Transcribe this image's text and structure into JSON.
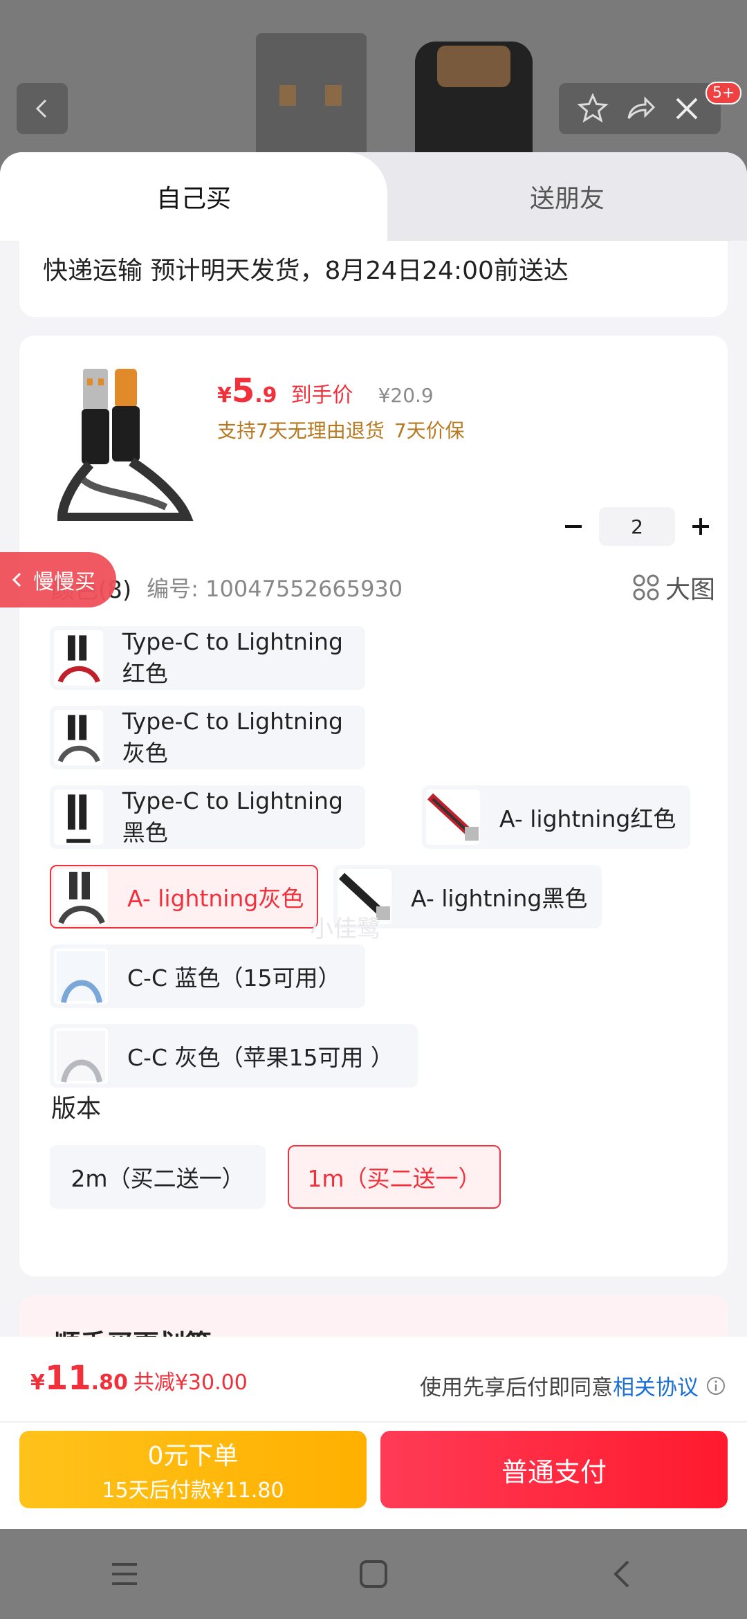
{
  "header": {
    "badge": "5+"
  },
  "tabs": {
    "self": "自己买",
    "friend": "送朋友"
  },
  "delivery": {
    "text": "快递运输 预计明天发货，8月24日24:00前送达"
  },
  "product": {
    "currency": "¥",
    "price_int": "5",
    "price_dec": ".9",
    "price_label": "到手价",
    "original_price": "¥20.9",
    "guarantees": [
      "支持7天无理由退货",
      "7天价保"
    ],
    "quantity": "2"
  },
  "color_section": {
    "title": "颜色(8)",
    "code": "编号: 10047552665930",
    "big_image_label": "大图",
    "options": [
      {
        "label": "Type-C to Lightning红色",
        "accent": "#c0202a",
        "selected": false
      },
      {
        "label": "Type-C to Lightning灰色",
        "accent": "#555555",
        "selected": false
      },
      {
        "label": "Type-C to Lightning黑色",
        "accent": "#222222",
        "selected": false
      },
      {
        "label": "A- lightning红色",
        "accent": "#c0202a",
        "selected": false
      },
      {
        "label": "A- lightning灰色",
        "accent": "#555555",
        "selected": true
      },
      {
        "label": "A- lightning黑色",
        "accent": "#222222",
        "selected": false
      },
      {
        "label": "C-C  蓝色（15可用）",
        "accent": "#7aa7d8",
        "selected": false
      },
      {
        "label": "C-C  灰色（苹果15可用 ）",
        "accent": "#b8b8c0",
        "selected": false
      }
    ]
  },
  "version_section": {
    "title": "版本",
    "options": [
      {
        "label": "2m（买二送一）",
        "selected": false
      },
      {
        "label": "1m（买二送一）",
        "selected": true
      }
    ]
  },
  "bundle": {
    "title": "顺手买更划算"
  },
  "float_tag": {
    "label": "慢慢买"
  },
  "watermark": "小佳鹭",
  "paybar": {
    "currency": "¥",
    "total_int": "11",
    "total_dec": ".80",
    "saving": "共减¥30.00",
    "agree_prefix": "使用先享后付即同意",
    "agree_link": "相关协议",
    "pay_later_line1": "0元下单",
    "pay_later_line2": "15天后付款¥11.80",
    "pay_normal": "普通支付"
  },
  "colors": {
    "accent": "#f0303a",
    "gold": "#b7791f",
    "link": "#1a6fd6"
  }
}
